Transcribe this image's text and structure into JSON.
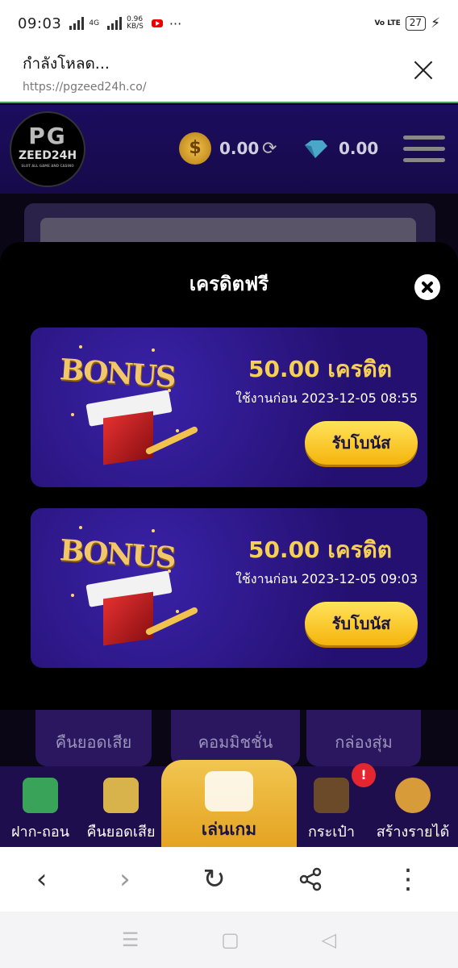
{
  "status_bar": {
    "time": "09:03",
    "network_type": "4G",
    "speed_value": "0.96",
    "speed_unit": "KB/S",
    "more": "···",
    "volte": "Vo LTE",
    "battery": "27"
  },
  "browser": {
    "loading_text": "กำลังโหลด...",
    "url": "https://pgzeed24h.co/"
  },
  "site_header": {
    "logo_line1": "PG",
    "logo_line2": "ZEED24H",
    "logo_tagline": "SLOT ALL GAME AND CASINO",
    "coin_symbol": "$",
    "coin_balance": "0.00",
    "gem_balance": "0.00"
  },
  "modal": {
    "title": "เครดิตฟรี",
    "cards": [
      {
        "bonus_word": "BONUS",
        "amount": "50.00 เครดิต",
        "expiry": "ใช้งานก่อน 2023-12-05 08:55",
        "button": "รับโบนัส"
      },
      {
        "bonus_word": "BONUS",
        "amount": "50.00 เครดิต",
        "expiry": "ใช้งานก่อน 2023-12-05 09:03",
        "button": "รับโบนัส"
      }
    ]
  },
  "menu_tiles": [
    "คืนยอดเสีย",
    "คอมมิชชั่น",
    "กล่องสุ่ม"
  ],
  "bottom_nav": {
    "items": [
      "ฝาก-ถอน",
      "คืนยอดเสีย",
      "เล่นเกม",
      "กระเป๋า",
      "สร้างรายได้"
    ],
    "badge": "!"
  },
  "browser_nav": {
    "back": "‹",
    "forward": "›",
    "reload": "↻",
    "share": "⤴",
    "menu": "⋮"
  },
  "colors": {
    "accent_gold": "#f6cf55",
    "card_purple": "#2a1490",
    "button_yellow": "#ffd02a"
  }
}
